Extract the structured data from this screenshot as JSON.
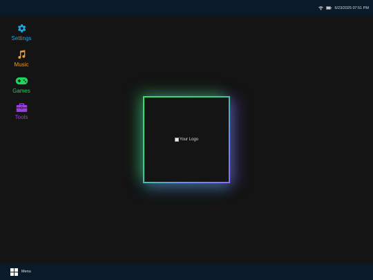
{
  "status_bar": {
    "datetime": "6/23/2025 07:51 PM",
    "icons": [
      "wifi-icon",
      "battery-icon"
    ]
  },
  "sidebar": {
    "items": [
      {
        "label": "Settings",
        "icon": "gear-icon",
        "color": "#19a9e6"
      },
      {
        "label": "Music",
        "icon": "music-note-icon",
        "color": "#f39a1e"
      },
      {
        "label": "Games",
        "icon": "gamepad-icon",
        "color": "#1fd45a"
      },
      {
        "label": "Tools",
        "icon": "toolbox-icon",
        "color": "#9b3fe0"
      }
    ]
  },
  "center": {
    "logo_alt": "Your Logo",
    "border_colors": [
      "#2fe56a",
      "#6a8cff",
      "#8a6cff"
    ]
  },
  "taskbar": {
    "menu_label": "Menu",
    "menu_icon": "windows-icon"
  }
}
